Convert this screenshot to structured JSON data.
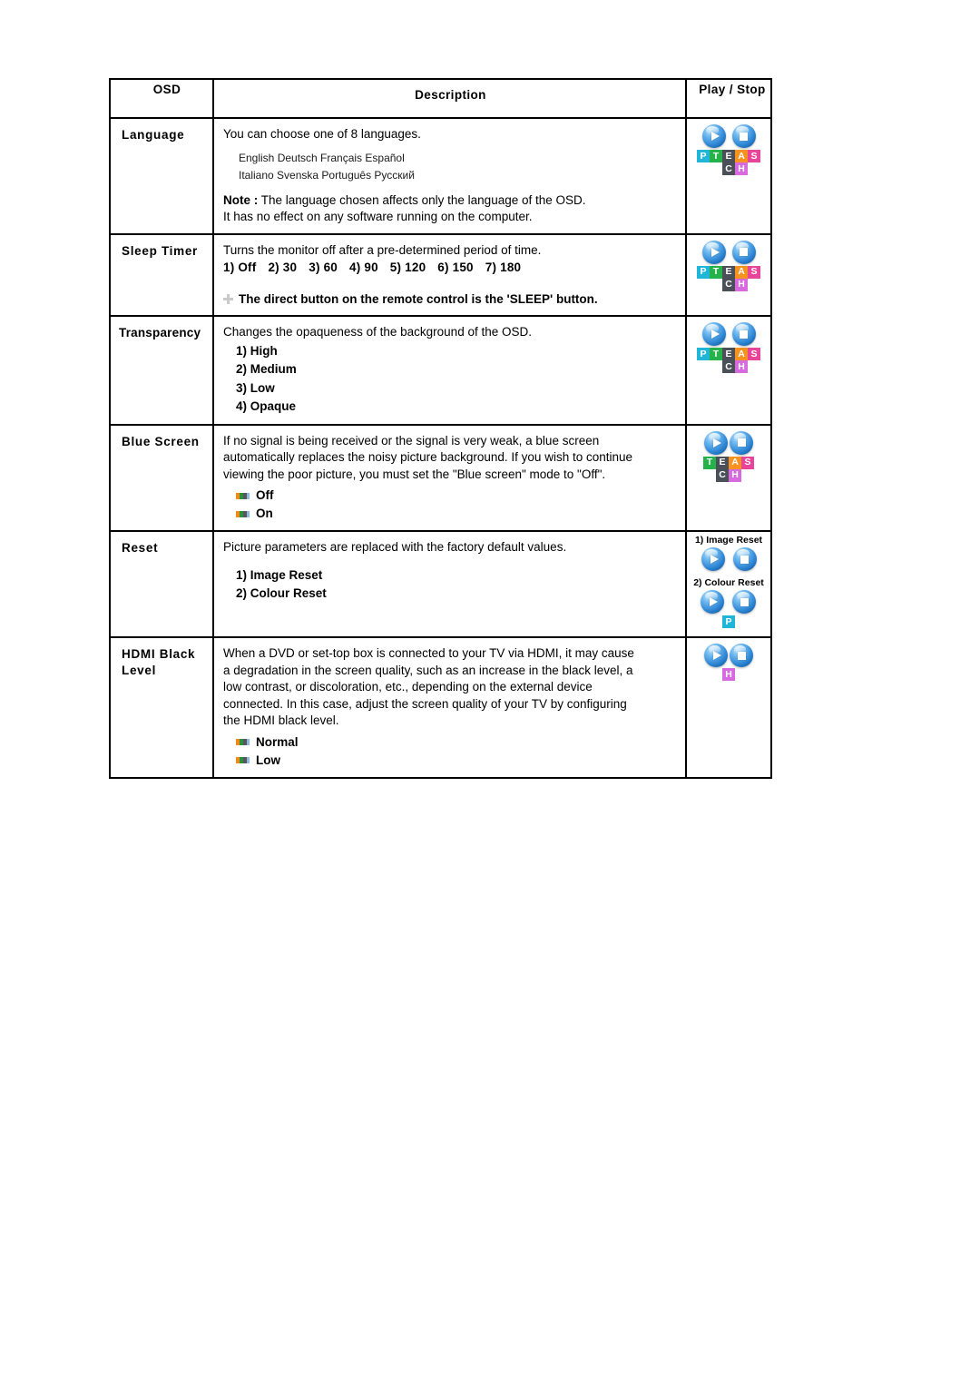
{
  "table": {
    "headers": {
      "osd": "OSD",
      "description": "Description",
      "play_stop": "Play / Stop"
    },
    "rows": [
      {
        "name": "Language",
        "lead": "You can choose one of 8 languages.",
        "languages_line1": "English Deutsch Français Español",
        "languages_line2": "Italiano Svenska Português Русский",
        "note_label": "Note :",
        "note_text": " The language chosen affects only the language of the OSD.",
        "note_text2": "It has no effect on any software running on the computer.",
        "icon_tiles_row1": [
          "P",
          "T",
          "E",
          "A",
          "S"
        ],
        "icon_tiles_row2": [
          "C",
          "H"
        ]
      },
      {
        "name": "Sleep Timer",
        "lead": "Turns the monitor off after a pre-determined period of time.",
        "options_inline": [
          "1) Off",
          "2) 30",
          "3) 60",
          "4) 90",
          "5) 120",
          "6) 150",
          "7) 180"
        ],
        "tip": "The direct button on the remote control is the 'SLEEP' button.",
        "icon_tiles_row1": [
          "P",
          "T",
          "E",
          "A",
          "S"
        ],
        "icon_tiles_row2": [
          "C",
          "H"
        ]
      },
      {
        "name": "Transparency",
        "lead": "Changes the opaqueness of the background of the OSD.",
        "options": [
          "1) High",
          "2) Medium",
          "3) Low",
          "4) Opaque"
        ],
        "icon_tiles_row1": [
          "P",
          "T",
          "E",
          "A",
          "S"
        ],
        "icon_tiles_row2": [
          "C",
          "H"
        ]
      },
      {
        "name": "Blue Screen",
        "lead1": "If no signal is being received or the signal is very weak, a blue screen",
        "lead2": "automatically replaces the noisy picture background. If you wish to continue",
        "lead3": "viewing the poor picture, you must set the \"Blue screen\" mode to \"Off\".",
        "bullets": [
          "Off",
          "On"
        ],
        "icon_tiles_row1": [
          "T",
          "E",
          "A",
          "S"
        ],
        "icon_tiles_row2": [
          "C",
          "H"
        ]
      },
      {
        "name": "Reset",
        "lead": "Picture parameters are replaced with the factory default values.",
        "options": [
          "1) Image Reset",
          "2) Colour Reset"
        ],
        "icon_group1_label": "1) Image Reset",
        "icon_group2_label": "2) Colour Reset",
        "icon_tile_p": "P"
      },
      {
        "name": "HDMI Black Level",
        "name_line1": "HDMI Black",
        "name_line2": "Level",
        "lead1": "When a DVD or set-top box is connected to your TV via HDMI, it may cause",
        "lead2": "a degradation in the screen quality, such as an increase in the black level, a",
        "lead3": "low contrast, or discoloration, etc., depending on the external device",
        "lead4": "connected. In this case, adjust the screen quality of your TV by configuring",
        "lead5": "the HDMI black level.",
        "bullets": [
          "Normal",
          "Low"
        ],
        "icon_tile_h": "H"
      }
    ]
  },
  "colors": {
    "tile_p": "#21b5d8",
    "tile_t": "#26b24b",
    "tile_e": "#4a4f58",
    "tile_a": "#f59220",
    "tile_s": "#e8459a",
    "tile_c": "#4a4f58",
    "tile_h": "#d86ae0",
    "orb_blue": "#2e86d4",
    "border": "#000000",
    "page_bg": "#ffffff"
  }
}
